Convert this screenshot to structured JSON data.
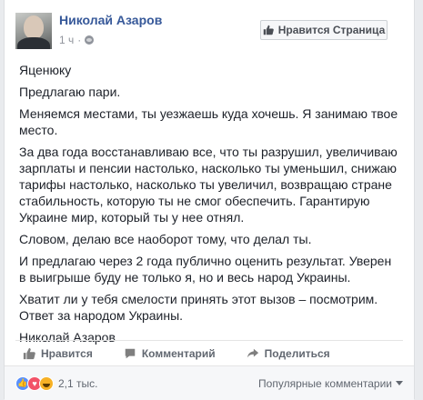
{
  "post": {
    "author": "Николай Азаров",
    "time": "1 ч",
    "like_page_label": "Нравится Страница",
    "paragraphs": [
      "Яценюку",
      "Предлагаю пари.",
      "Меняемся местами, ты уезжаешь куда хочешь. Я занимаю твое место.",
      "За два года восстанавливаю все, что ты разрушил, увеличиваю зарплаты и пенсии настолько, насколько ты уменьшил, снижаю тарифы настолько, насколько ты увеличил, возвращаю стране стабильность, которую ты не смог обеспечить. Гарантирую Украине мир, который ты у нее отнял.",
      "Словом, делаю все наоборот тому, что делал ты.",
      "И предлагаю через 2 года публично оценить результат. Уверен в выигрыше буду не только я, но и весь народ Украины.",
      "Хватит ли у тебя смелости принять этот вызов – посмотрим.",
      "Ответ за народом Украины.",
      "Николай Азаров"
    ]
  },
  "actions": {
    "like": "Нравится",
    "comment": "Комментарий",
    "share": "Поделиться"
  },
  "reactions": {
    "count": "2,1 тыс.",
    "sort_label": "Популярные комментарии",
    "types": [
      "like-icon",
      "love-icon",
      "haha-icon"
    ]
  },
  "colors": {
    "link": "#365899",
    "background": "#e9ebee",
    "like": "#5890ff",
    "love": "#f25268",
    "haha": "#f7b125"
  }
}
